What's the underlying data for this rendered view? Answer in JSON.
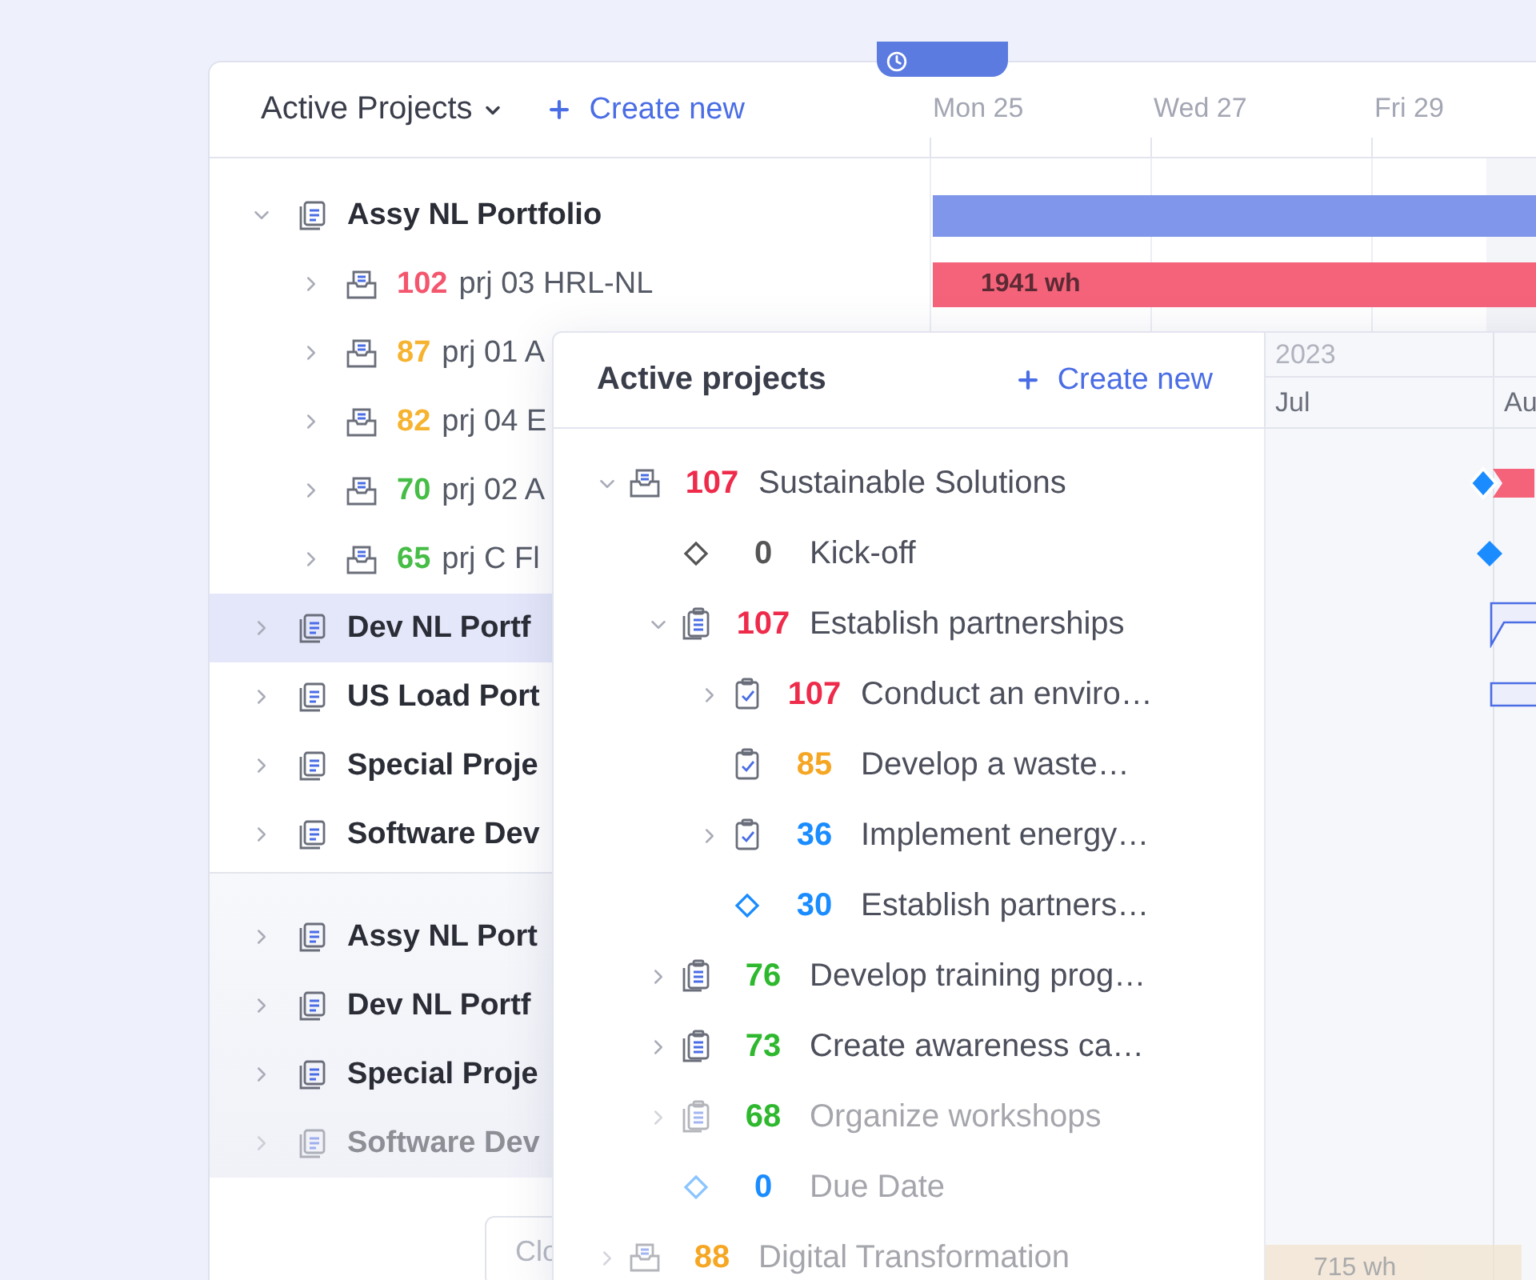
{
  "background_card": {
    "title": "Active Projects",
    "create_label": "Create new",
    "days": [
      "Mon 25",
      "Wed 27",
      "Fri 29"
    ],
    "sections": [
      {
        "items": [
          {
            "kind": "portfolio",
            "name": "Assy NL Portfolio",
            "expanded": true,
            "selected": false,
            "children": [
              {
                "kind": "project",
                "number": "102",
                "color": "#f4566e",
                "name": "prj 03 HRL-NL",
                "expanded": false,
                "selected": false
              },
              {
                "kind": "project",
                "number": "87",
                "color": "#f6b32f",
                "name": "prj 01 A",
                "expanded": false,
                "selected": false
              },
              {
                "kind": "project",
                "number": "82",
                "color": "#f6b32f",
                "name": "prj 04 E",
                "expanded": false,
                "selected": false
              },
              {
                "kind": "project",
                "number": "70",
                "color": "#46bd46",
                "name": "prj 02 A",
                "expanded": false,
                "selected": false
              },
              {
                "kind": "project",
                "number": "65",
                "color": "#46bd46",
                "name": "prj C Fl",
                "expanded": false,
                "selected": false
              }
            ]
          },
          {
            "kind": "portfolio",
            "name": "Dev NL Portf",
            "expanded": false,
            "selected": true
          },
          {
            "kind": "portfolio",
            "name": "US Load Port",
            "expanded": false,
            "selected": false
          },
          {
            "kind": "portfolio",
            "name": "Special Proje",
            "expanded": false,
            "selected": false
          },
          {
            "kind": "portfolio",
            "name": "Software Dev",
            "expanded": false,
            "selected": false
          }
        ]
      },
      {
        "items": [
          {
            "kind": "portfolio",
            "name": "Assy NL Port",
            "expanded": false,
            "selected": false
          },
          {
            "kind": "portfolio",
            "name": "Dev NL Portf",
            "expanded": false,
            "selected": false
          },
          {
            "kind": "portfolio",
            "name": "Special Proje",
            "expanded": false,
            "selected": false
          },
          {
            "kind": "portfolio",
            "name": "Software Dev",
            "expanded": false,
            "selected": false,
            "faded": true
          }
        ]
      }
    ],
    "bars": [
      {
        "kind": "summary"
      },
      {
        "kind": "task",
        "label": "1941 wh"
      }
    ],
    "button": {
      "label": "Clo"
    }
  },
  "panel": {
    "title": "Active projects",
    "create_label": "Create new",
    "year": "2023",
    "months": [
      "Jul",
      "Au"
    ],
    "tree": [
      {
        "kind": "project",
        "number": "107",
        "color": "#ee2b4a",
        "name": "Sustainable Solutions",
        "expanded": true,
        "bar": {
          "kind": "milestone-start"
        },
        "children": [
          {
            "kind": "milestone",
            "number": "0",
            "color": "#555555",
            "name": "Kick-off",
            "bar": {
              "kind": "milestone"
            }
          },
          {
            "kind": "group",
            "number": "107",
            "color": "#ee2b4a",
            "name": "Establish partnerships",
            "expanded": true,
            "bar": {
              "kind": "group"
            },
            "children": [
              {
                "kind": "task",
                "number": "107",
                "color": "#ee2b4a",
                "name": "Conduct an enviro…",
                "expanded": false,
                "bar": {
                  "kind": "task"
                }
              },
              {
                "kind": "task",
                "number": "85",
                "color": "#f5a623",
                "name": "Develop a waste…"
              },
              {
                "kind": "task",
                "number": "36",
                "color": "#1a8cff",
                "name": "Implement energy…",
                "expanded": false
              },
              {
                "kind": "milestone",
                "number": "30",
                "color": "#1a8cff",
                "name": "Establish partners…"
              }
            ]
          },
          {
            "kind": "group",
            "number": "76",
            "color": "#2eb82e",
            "name": "Develop training prog…",
            "expanded": false
          },
          {
            "kind": "group",
            "number": "73",
            "color": "#2eb82e",
            "name": "Create awareness ca…",
            "expanded": false
          },
          {
            "kind": "group",
            "number": "68",
            "color": "#2eb82e",
            "name": "Organize workshops",
            "expanded": false,
            "faded": true
          },
          {
            "kind": "milestone",
            "number": "0",
            "color": "#1a8cff",
            "name": "Due Date",
            "faded": true
          }
        ]
      },
      {
        "kind": "project",
        "number": "88",
        "color": "#f5a623",
        "name": "Digital Transformation",
        "expanded": false,
        "faded": true,
        "bar": {
          "kind": "work",
          "label": "715 wh"
        }
      }
    ]
  }
}
